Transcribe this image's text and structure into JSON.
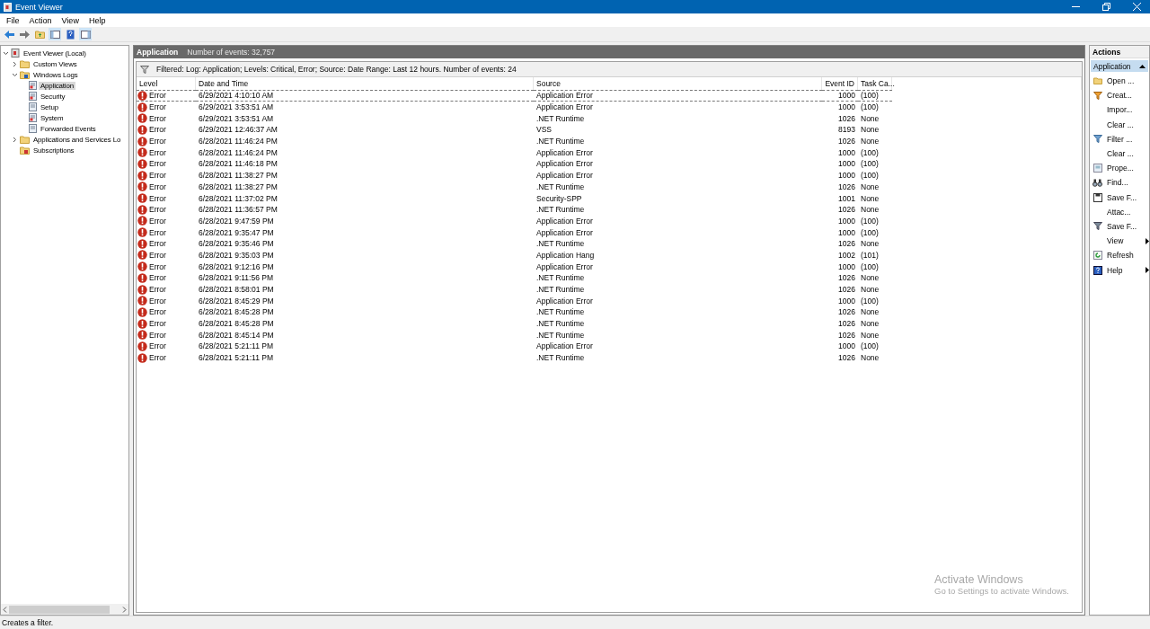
{
  "window": {
    "title": "Event Viewer"
  },
  "menu": [
    "File",
    "Action",
    "View",
    "Help"
  ],
  "tree": [
    {
      "label": "Event Viewer (Local)",
      "kind": "root",
      "selected": false,
      "expanded": true,
      "children": [
        {
          "label": "Custom Views",
          "kind": "folder",
          "selected": false,
          "expanded": false
        },
        {
          "label": "Windows Logs",
          "kind": "logs",
          "selected": false,
          "expanded": true,
          "children": [
            {
              "label": "Application",
              "kind": "log",
              "selected": true
            },
            {
              "label": "Security",
              "kind": "log",
              "selected": false
            },
            {
              "label": "Setup",
              "kind": "plainlog",
              "selected": false
            },
            {
              "label": "System",
              "kind": "log",
              "selected": false
            },
            {
              "label": "Forwarded Events",
              "kind": "plainlog",
              "selected": false
            }
          ]
        },
        {
          "label": "Applications and Services Lo",
          "kind": "folder",
          "selected": false,
          "expanded": false
        },
        {
          "label": "Subscriptions",
          "kind": "subs",
          "selected": false
        }
      ]
    }
  ],
  "header": {
    "title": "Application",
    "count": "Number of events: 32,757"
  },
  "filter": "Filtered: Log: Application; Levels: Critical, Error; Source: Date Range: Last 12 hours. Number of events: 24",
  "table": {
    "columns": [
      "Level",
      "Date and Time",
      "Source",
      "Event ID",
      "Task Ca..."
    ],
    "rows": [
      {
        "level": "Error",
        "date": "6/29/2021 4:10:10 AM",
        "source": "Application Error",
        "id": "1000",
        "task": "(100)",
        "selected": true
      },
      {
        "level": "Error",
        "date": "6/29/2021 3:53:51 AM",
        "source": "Application Error",
        "id": "1000",
        "task": "(100)",
        "selected": false
      },
      {
        "level": "Error",
        "date": "6/29/2021 3:53:51 AM",
        "source": ".NET Runtime",
        "id": "1026",
        "task": "None",
        "selected": false
      },
      {
        "level": "Error",
        "date": "6/29/2021 12:46:37 AM",
        "source": "VSS",
        "id": "8193",
        "task": "None",
        "selected": false
      },
      {
        "level": "Error",
        "date": "6/28/2021 11:46:24 PM",
        "source": ".NET Runtime",
        "id": "1026",
        "task": "None",
        "selected": false
      },
      {
        "level": "Error",
        "date": "6/28/2021 11:46:24 PM",
        "source": "Application Error",
        "id": "1000",
        "task": "(100)",
        "selected": false
      },
      {
        "level": "Error",
        "date": "6/28/2021 11:46:18 PM",
        "source": "Application Error",
        "id": "1000",
        "task": "(100)",
        "selected": false
      },
      {
        "level": "Error",
        "date": "6/28/2021 11:38:27 PM",
        "source": "Application Error",
        "id": "1000",
        "task": "(100)",
        "selected": false
      },
      {
        "level": "Error",
        "date": "6/28/2021 11:38:27 PM",
        "source": ".NET Runtime",
        "id": "1026",
        "task": "None",
        "selected": false
      },
      {
        "level": "Error",
        "date": "6/28/2021 11:37:02 PM",
        "source": "Security-SPP",
        "id": "1001",
        "task": "None",
        "selected": false
      },
      {
        "level": "Error",
        "date": "6/28/2021 11:36:57 PM",
        "source": ".NET Runtime",
        "id": "1026",
        "task": "None",
        "selected": false
      },
      {
        "level": "Error",
        "date": "6/28/2021 9:47:59 PM",
        "source": "Application Error",
        "id": "1000",
        "task": "(100)",
        "selected": false
      },
      {
        "level": "Error",
        "date": "6/28/2021 9:35:47 PM",
        "source": "Application Error",
        "id": "1000",
        "task": "(100)",
        "selected": false
      },
      {
        "level": "Error",
        "date": "6/28/2021 9:35:46 PM",
        "source": ".NET Runtime",
        "id": "1026",
        "task": "None",
        "selected": false
      },
      {
        "level": "Error",
        "date": "6/28/2021 9:35:03 PM",
        "source": "Application Hang",
        "id": "1002",
        "task": "(101)",
        "selected": false
      },
      {
        "level": "Error",
        "date": "6/28/2021 9:12:16 PM",
        "source": "Application Error",
        "id": "1000",
        "task": "(100)",
        "selected": false
      },
      {
        "level": "Error",
        "date": "6/28/2021 9:11:56 PM",
        "source": ".NET Runtime",
        "id": "1026",
        "task": "None",
        "selected": false
      },
      {
        "level": "Error",
        "date": "6/28/2021 8:58:01 PM",
        "source": ".NET Runtime",
        "id": "1026",
        "task": "None",
        "selected": false
      },
      {
        "level": "Error",
        "date": "6/28/2021 8:45:29 PM",
        "source": "Application Error",
        "id": "1000",
        "task": "(100)",
        "selected": false
      },
      {
        "level": "Error",
        "date": "6/28/2021 8:45:28 PM",
        "source": ".NET Runtime",
        "id": "1026",
        "task": "None",
        "selected": false
      },
      {
        "level": "Error",
        "date": "6/28/2021 8:45:28 PM",
        "source": ".NET Runtime",
        "id": "1026",
        "task": "None",
        "selected": false
      },
      {
        "level": "Error",
        "date": "6/28/2021 8:45:14 PM",
        "source": ".NET Runtime",
        "id": "1026",
        "task": "None",
        "selected": false
      },
      {
        "level": "Error",
        "date": "6/28/2021 5:21:11 PM",
        "source": "Application Error",
        "id": "1000",
        "task": "(100)",
        "selected": false
      },
      {
        "level": "Error",
        "date": "6/28/2021 5:21:11 PM",
        "source": ".NET Runtime",
        "id": "1026",
        "task": "None",
        "selected": false
      }
    ]
  },
  "actions": {
    "title": "Actions",
    "section": "Application",
    "items": [
      {
        "label": "Open ...",
        "kind": "open"
      },
      {
        "label": "Creat...",
        "kind": "createfilter"
      },
      {
        "label": "Impor...",
        "kind": "plain"
      },
      {
        "label": "Clear ...",
        "kind": "plain"
      },
      {
        "label": "Filter ...",
        "kind": "filter"
      },
      {
        "label": "Clear ...",
        "kind": "plain"
      },
      {
        "label": "Prope...",
        "kind": "properties"
      },
      {
        "label": "Find...",
        "kind": "find"
      },
      {
        "label": "Save F...",
        "kind": "save"
      },
      {
        "label": "Attac...",
        "kind": "plain"
      },
      {
        "label": "Save F...",
        "kind": "savefilter"
      },
      {
        "label": "View",
        "kind": "submenu"
      },
      {
        "label": "Refresh",
        "kind": "refresh"
      },
      {
        "label": "Help",
        "kind": "help"
      }
    ]
  },
  "status_bar": "Creates a filter.",
  "activation": {
    "title": "Activate Windows",
    "subtitle": "Go to Settings to activate Windows."
  }
}
